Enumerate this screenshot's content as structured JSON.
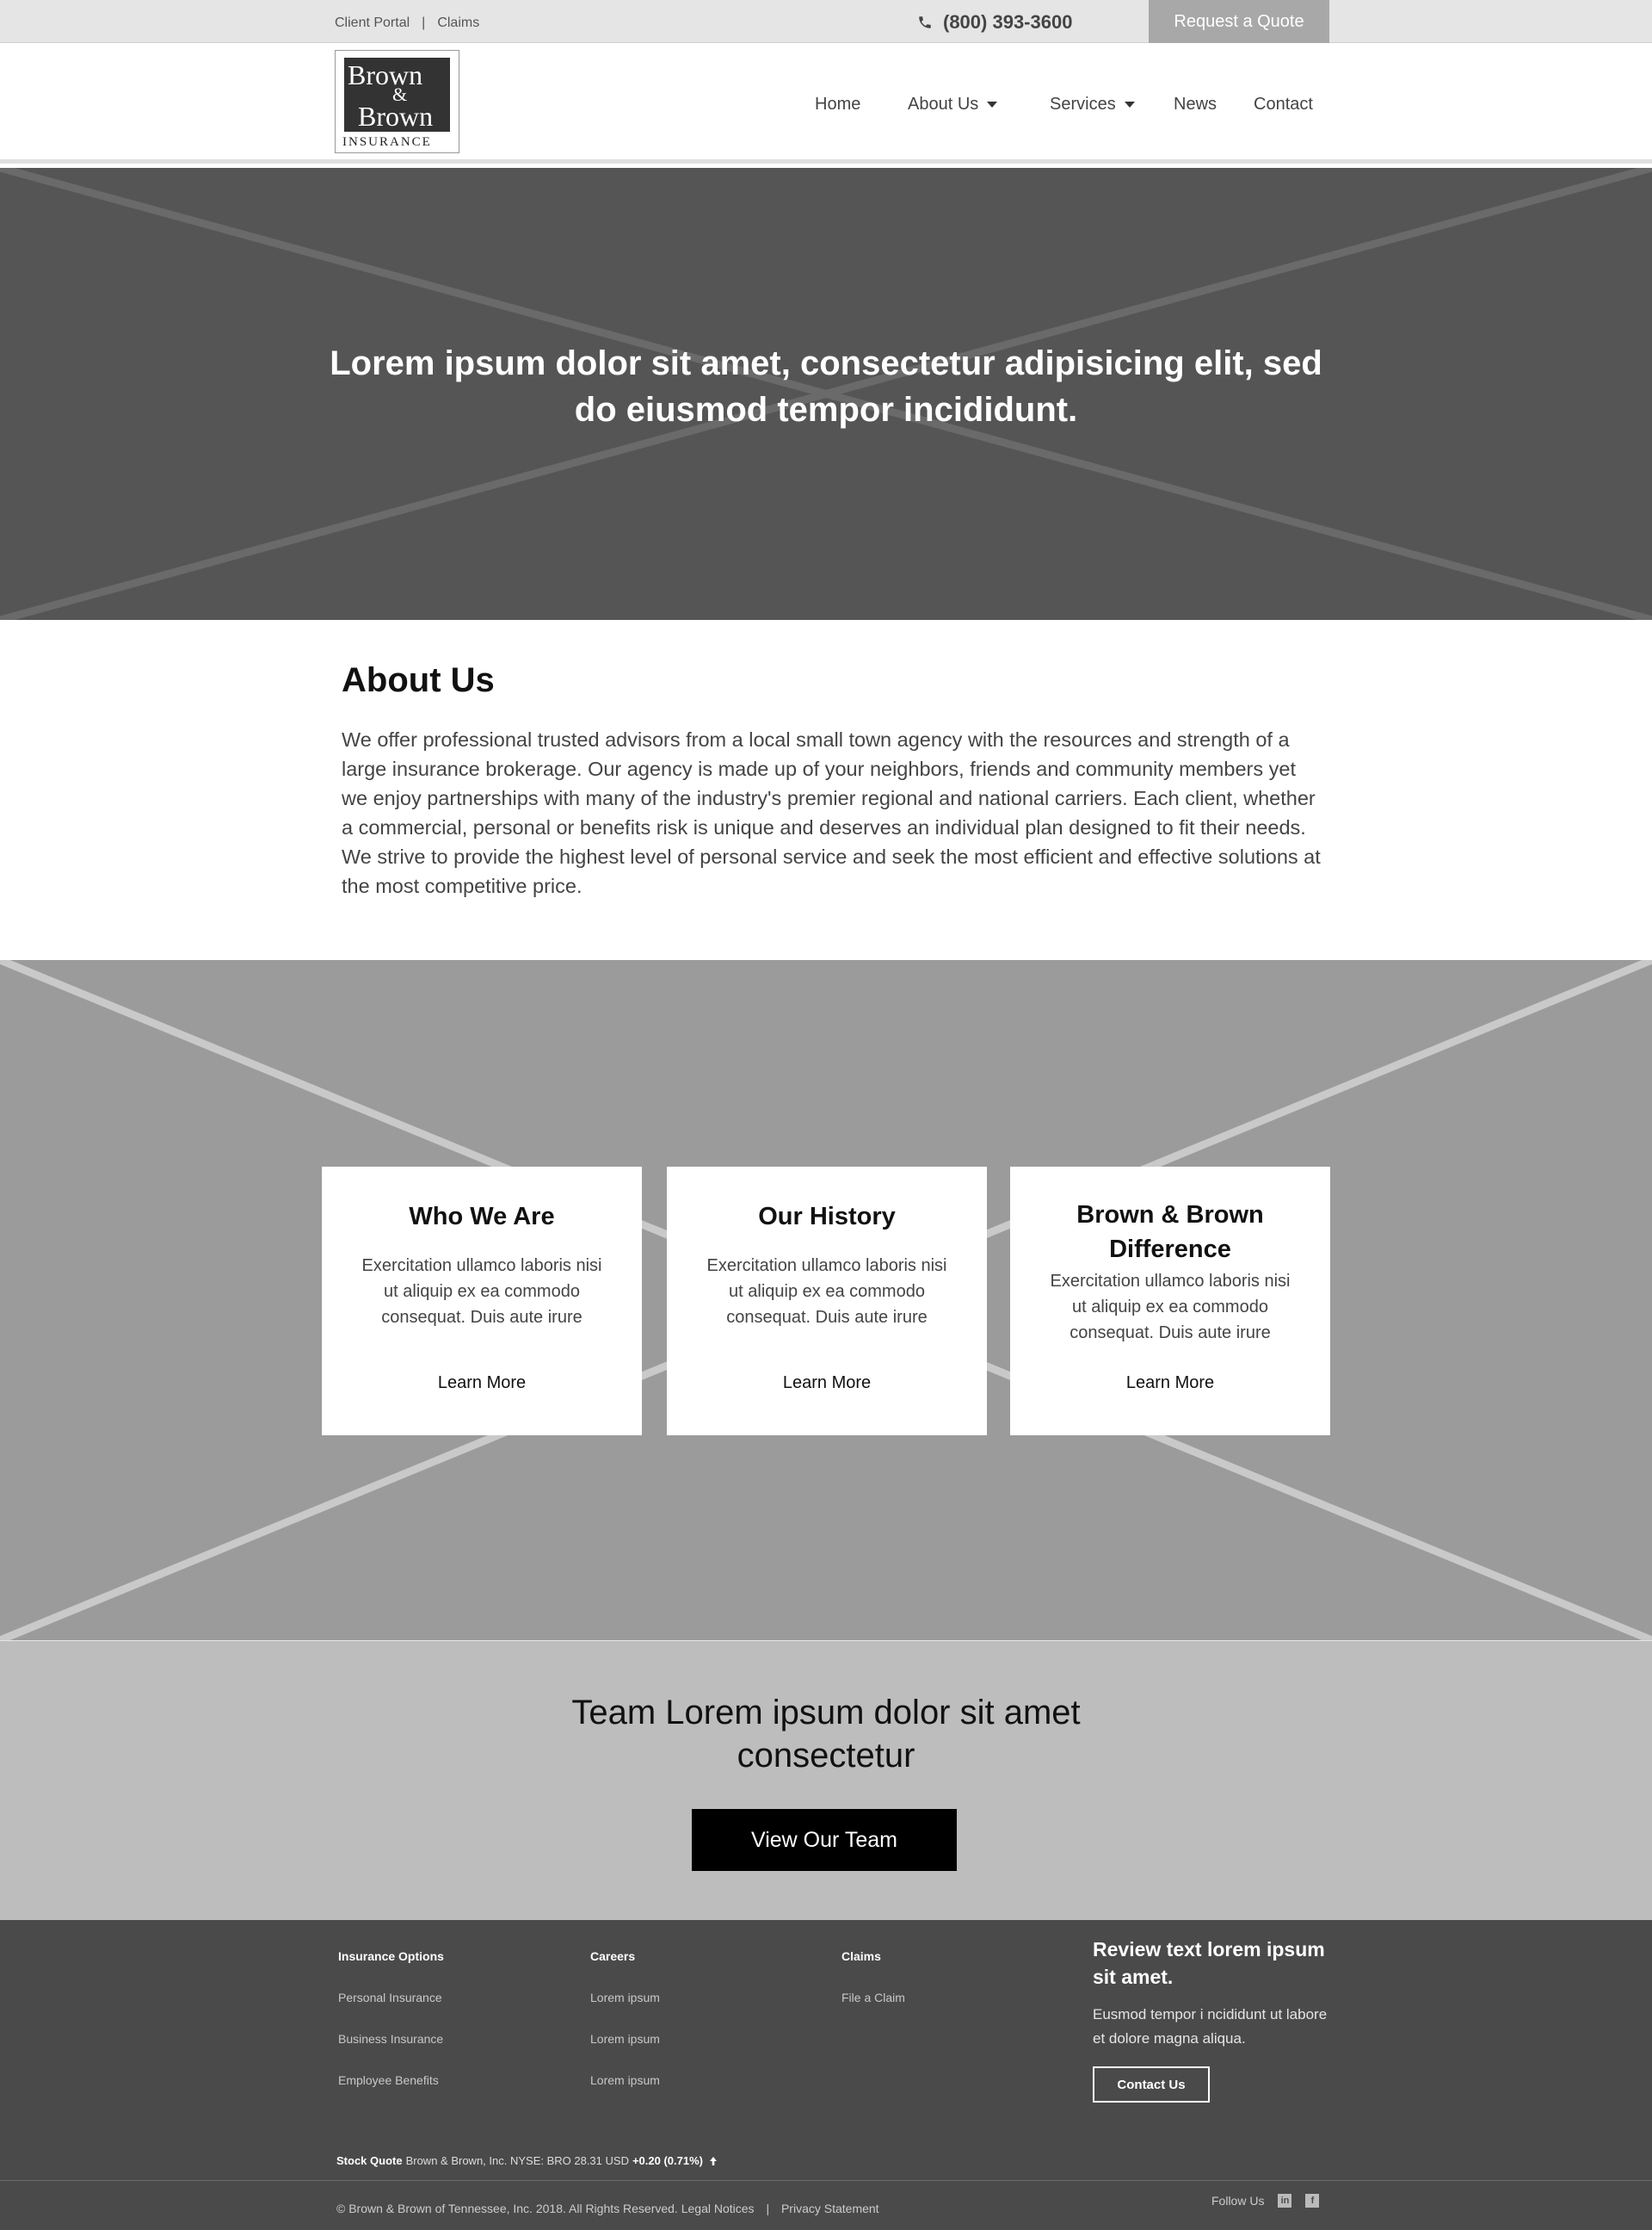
{
  "utility": {
    "links": [
      "Client Portal",
      "Claims"
    ],
    "separator": "|",
    "phone": "(800) 393-3600",
    "quote_label": "Request a Quote"
  },
  "logo": {
    "line1": "Brown",
    "amp": "&",
    "line2": "Brown",
    "line3": "INSURANCE"
  },
  "nav": {
    "items": [
      {
        "label": "Home"
      },
      {
        "label": "About Us"
      },
      {
        "label": "Services"
      },
      {
        "label": "News"
      },
      {
        "label": "Contact"
      }
    ]
  },
  "hero": {
    "headline": "Lorem ipsum dolor sit amet, consectetur adipisicing elit, sed do eiusmod tempor incididunt."
  },
  "about": {
    "title": "About Us",
    "body": "We offer professional trusted advisors from a local small town agency with the resources and strength of a large insurance brokerage. Our agency is made up of your neighbors, friends and community members yet we enjoy partnerships with many of the industry's premier regional and national carriers. Each client, whether a commercial, personal or benefits risk is unique and deserves an individual plan designed to fit their needs. We strive to provide the highest level of personal service and seek the most efficient and effective solutions at the most competitive price."
  },
  "cards": [
    {
      "title": "Who We Are",
      "text": "Exercitation ullamco laboris nisi ut aliquip ex ea commodo consequat. Duis aute irure",
      "link": "Learn More"
    },
    {
      "title": "Our History",
      "text": "Exercitation ullamco laboris nisi ut aliquip ex ea commodo consequat. Duis aute irure",
      "link": "Learn More"
    },
    {
      "title": "Brown & Brown Difference",
      "text": "Exercitation ullamco laboris nisi ut aliquip ex ea commodo consequat. Duis aute irure",
      "link": "Learn More"
    }
  ],
  "team": {
    "headline": "Team Lorem ipsum dolor sit amet consectetur",
    "button": "View Our Team"
  },
  "footer": {
    "columns": [
      {
        "head": "Insurance Options",
        "items": [
          "Personal Insurance",
          "Business Insurance",
          "Employee Benefits"
        ]
      },
      {
        "head": "Careers",
        "items": [
          "Lorem ipsum",
          "Lorem ipsum",
          "Lorem ipsum"
        ]
      },
      {
        "head": "Claims",
        "items": [
          "File a Claim"
        ]
      }
    ],
    "review": {
      "title": "Review text lorem ipsum sit amet.",
      "text": "Eusmod tempor i ncididunt ut labore et dolore magna aliqua.",
      "button": "Contact Us"
    },
    "stock": {
      "label": "Stock Quote",
      "detail": "Brown & Brown, Inc. NYSE: BRO 28.31 USD",
      "change": "+0.20 (0.71%)",
      "direction_icon": "arrow-up-icon"
    },
    "copyright": "© Brown & Brown of Tennessee, Inc. 2018. All Rights Reserved.",
    "legal": "Legal Notices",
    "privacy": "Privacy Statement",
    "follow": "Follow Us",
    "social": [
      "in",
      "f"
    ]
  },
  "colors": {
    "utility_bg": "#e5e5e5",
    "hero_bg": "#555555",
    "features_bg": "#9b9b9b",
    "team_bg": "#bdbdbd",
    "footer_bg": "#4a4a4a",
    "quote_button_bg": "#a8a8a8"
  }
}
